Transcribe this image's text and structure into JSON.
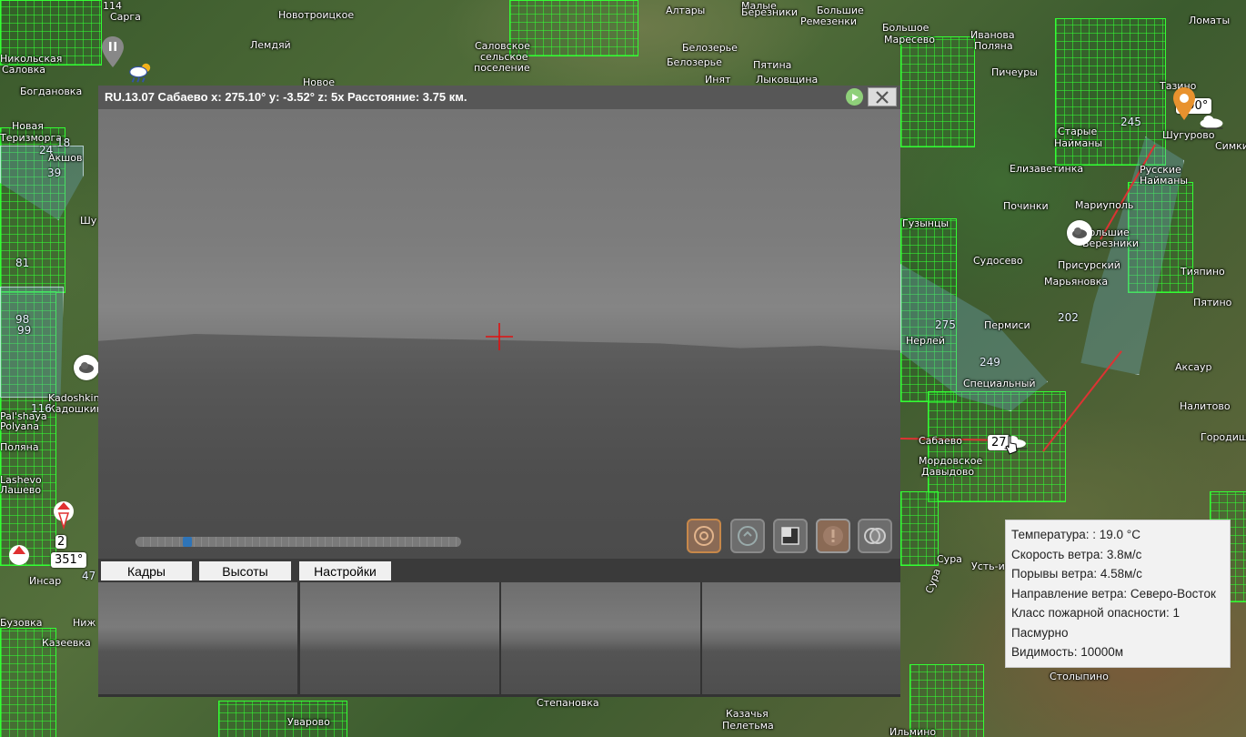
{
  "camera": {
    "title": "RU.13.07 Сабаево x: 275.10° y: -3.52° z: 5x Расстояние: 3.75 км.",
    "timeline_position": 0.15,
    "tabs": [
      "Кадры",
      "Высоты",
      "Настройки"
    ]
  },
  "weather": {
    "temperature": "Температура: : 19.0 °C",
    "wind_speed": "Скорость ветра: 3.8м/с",
    "wind_gusts": "Порывы ветра: 4.58м/с",
    "wind_direction": "Направление ветра: Северо-Восток",
    "fire_class": "Класс пожарной опасности: 1",
    "condition": "Пасмурно",
    "visibility": "Видимость: 10000м"
  },
  "map": {
    "places": [
      "114",
      "Сарга",
      "Новотроицкое",
      "Алтары",
      "Малые",
      "Березники",
      "Большие",
      "Ремезенки",
      "Ломаты",
      "Лемдяй",
      "Саловское",
      "сельское",
      "поселение",
      "Белозерье",
      "Белозерье",
      "Большое",
      "Маресево",
      "Ивановa",
      "Поляна",
      "Пичеуры",
      "Тазино",
      "Шугурово",
      "Симки",
      "Старые",
      "Найманы",
      "245",
      "Пятина",
      "Лыковщина",
      "Инят",
      "Новое",
      "Богдановка",
      "Никольская",
      "Саловка",
      "Новая",
      "Теризморга",
      "Акшов",
      "Елизаветинка",
      "Русские",
      "Найманы",
      "Починки",
      "Мариуполь",
      "Гузынцы",
      "Большие",
      "Березники",
      "Тияпино",
      "Пятино",
      "Судосево",
      "Присурский",
      "Марьяновка",
      "Нерлей",
      "Пермиси",
      "202",
      "275",
      "249",
      "Аксаур",
      "Специальный",
      "Налитово",
      "Сабаево",
      "Мордовское",
      "Давыдово",
      "Городищ",
      "Kadoshkino",
      "Кадошкино",
      "Pal'shaya",
      "Polyana",
      "Поляна",
      "Lashevo",
      "Лашево",
      "Инсар",
      "Бузовка",
      "Казеевка",
      "Ниж",
      "Сура",
      "Усть-и",
      "Столыпино",
      "Степановка",
      "Уварово",
      "Казачья",
      "Пелетьма",
      "Ильмино",
      "Шу",
      "Сура",
      "81",
      "39",
      "98",
      "99",
      "116",
      "18",
      "24",
      "47",
      "351°",
      "2",
      "290°",
      "27"
    ],
    "wind_badges": [
      "351°",
      "2",
      "290°",
      "27"
    ]
  },
  "colors": {
    "forest_grid": "#33ff33",
    "border_line": "#d33333",
    "crosshair": "#e01010",
    "timeline_thumb": "#2e74b8",
    "header_bg": "#575757"
  },
  "icons": [
    "play-icon",
    "close-icon",
    "crosshair-icon",
    "photo-icon",
    "refresh-icon",
    "window-icon",
    "warning-icon",
    "overlay-icon",
    "cloud-icon",
    "rain-icon",
    "location-pin-icon",
    "pause-icon"
  ]
}
